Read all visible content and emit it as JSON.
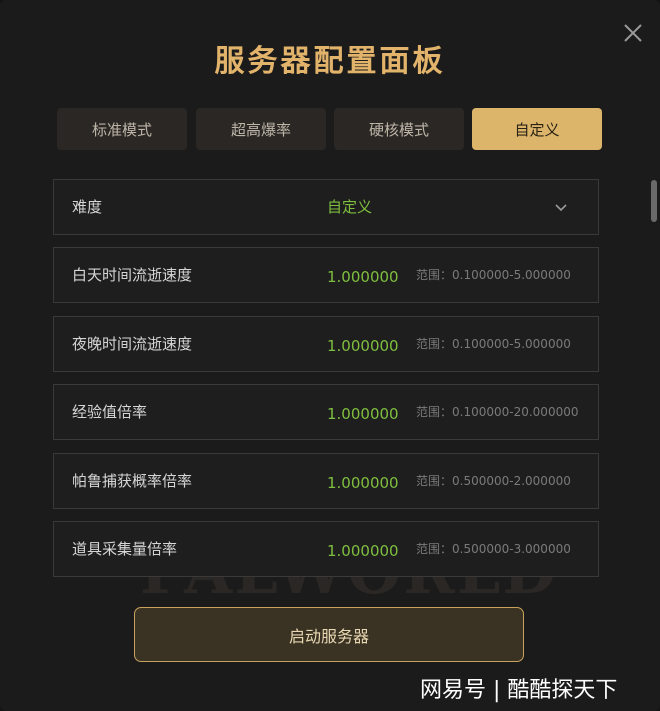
{
  "panel": {
    "title": "服务器配置面板",
    "watermark": "PALWORLD"
  },
  "tabs": [
    {
      "label": "标准模式",
      "active": false
    },
    {
      "label": "超高爆率",
      "active": false
    },
    {
      "label": "硬核模式",
      "active": false
    },
    {
      "label": "自定义",
      "active": true
    }
  ],
  "difficulty": {
    "label": "难度",
    "value": "自定义"
  },
  "settings": [
    {
      "label": "白天时间流逝速度",
      "value": "1.000000",
      "range": "范围：0.100000-5.000000"
    },
    {
      "label": "夜晚时间流逝速度",
      "value": "1.000000",
      "range": "范围：0.100000-5.000000"
    },
    {
      "label": "经验值倍率",
      "value": "1.000000",
      "range": "范围：0.100000-20.000000"
    },
    {
      "label": "帕鲁捕获概率倍率",
      "value": "1.000000",
      "range": "范围：0.500000-2.000000"
    },
    {
      "label": "道具采集量倍率",
      "value": "1.000000",
      "range": "范围：0.500000-3.000000"
    }
  ],
  "actions": {
    "start_label": "启动服务器"
  },
  "credit": "网易号 | 酷酷探天下",
  "colors": {
    "accent": "#dcb56a",
    "value_green": "#7fbf3f",
    "background": "#1b1b1b"
  },
  "icons": {
    "close": "close-icon",
    "dropdown": "chevron-down-icon"
  }
}
